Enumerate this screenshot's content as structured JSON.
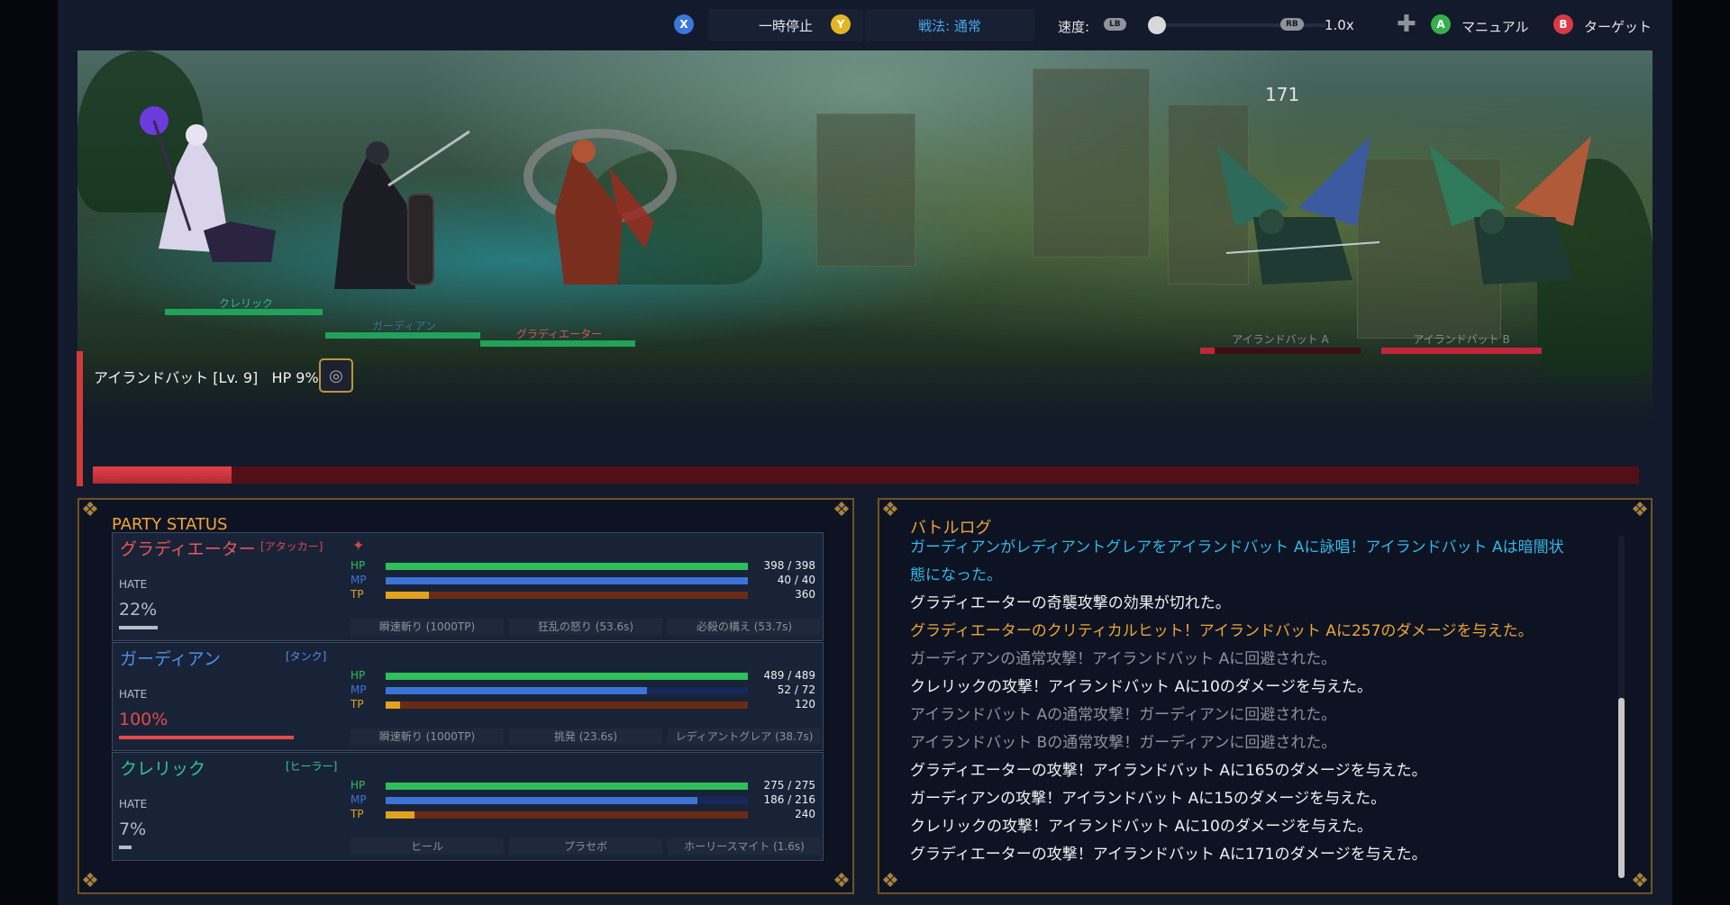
{
  "controls": {
    "pause": {
      "key": "X",
      "label": "一時停止",
      "key_color": "#3a78d8"
    },
    "tactics": {
      "key": "Y",
      "label": "戦法: 通常",
      "key_color": "#e2b623"
    },
    "speed": {
      "label": "速度:",
      "lb": "LB",
      "rb": "RB",
      "value": "1.0x"
    },
    "manual": {
      "key": "A",
      "label": "マニュアル",
      "key_color": "#35b04b"
    },
    "target": {
      "key": "B",
      "label": "ターゲット",
      "key_color": "#d83a45"
    }
  },
  "scene": {
    "damage_popup": "171",
    "party": [
      {
        "name": "クレリック",
        "hp_fraction": 1.0,
        "color": "#21a25a"
      },
      {
        "name": "ガーディアン",
        "hp_fraction": 1.0,
        "color": "#21a25a"
      },
      {
        "name": "グラディエーター",
        "hp_fraction": 1.0,
        "color": "#21a25a"
      }
    ],
    "enemies": [
      {
        "name": "アイランドバット A",
        "hp_fraction": 0.09,
        "color": "#c0263a"
      },
      {
        "name": "アイランドバット B",
        "hp_fraction": 1.0,
        "color": "#c0263a"
      }
    ]
  },
  "target": {
    "label": "アイランドバット [Lv. 9]",
    "hp_text": "HP 9%",
    "hp_fraction": 0.09
  },
  "party_status": {
    "title": "PARTY STATUS",
    "members": [
      {
        "name": "グラディエーター",
        "role": "[アタッカー]",
        "name_color": "#e8575a",
        "role_color": "#d84a4a",
        "hate_label": "HATE",
        "hate_value": "22%",
        "hate_fraction": 0.22,
        "hate_color": "#b8bcc6",
        "hp": {
          "label": "HP",
          "text": "398 / 398",
          "fraction": 1.0
        },
        "mp": {
          "label": "MP",
          "text": "40 / 40",
          "fraction": 1.0
        },
        "tp": {
          "label": "TP",
          "text": "360",
          "fraction": 0.12
        },
        "skills": [
          "瞬速斬り (1000TP)",
          "狂乱の怒り (53.6s)",
          "必殺の構え (53.7s)"
        ]
      },
      {
        "name": "ガーディアン",
        "role": "[タンク]",
        "name_color": "#4f8fe6",
        "role_color": "#4f8fe6",
        "hate_label": "HATE",
        "hate_value": "100%",
        "hate_fraction": 1.0,
        "hate_color": "#e24a4a",
        "hp": {
          "label": "HP",
          "text": "489 / 489",
          "fraction": 1.0
        },
        "mp": {
          "label": "MP",
          "text": "52 / 72",
          "fraction": 0.722
        },
        "tp": {
          "label": "TP",
          "text": "120",
          "fraction": 0.04
        },
        "skills": [
          "瞬速斬り (1000TP)",
          "挑発 (23.6s)",
          "レディアントグレア (38.7s)"
        ]
      },
      {
        "name": "クレリック",
        "role": "[ヒーラー]",
        "name_color": "#2fc68f",
        "role_color": "#2fc68f",
        "hate_label": "HATE",
        "hate_value": "7%",
        "hate_fraction": 0.07,
        "hate_color": "#b8bcc6",
        "hp": {
          "label": "HP",
          "text": "275 / 275",
          "fraction": 1.0
        },
        "mp": {
          "label": "MP",
          "text": "186 / 216",
          "fraction": 0.861
        },
        "tp": {
          "label": "TP",
          "text": "240",
          "fraction": 0.08
        },
        "skills": [
          "ヒール",
          "プラセボ",
          "ホーリースマイト (1.6s)"
        ]
      }
    ]
  },
  "battle_log": {
    "title": "バトルログ",
    "lines": [
      {
        "text": "ガーディアンがレディアントグレアをアイランドバット Aに詠唱！アイランドバット Aは暗闇状",
        "color": "#35b7e6"
      },
      {
        "text": "態になった。",
        "color": "#35b7e6"
      },
      {
        "text": "グラディエーターの奇襲攻撃の効果が切れた。",
        "color": "#f2f2f2"
      },
      {
        "text": "グラディエーターのクリティカルヒット！アイランドバット Aに257のダメージを与えた。",
        "color": "#f0a637"
      },
      {
        "text": "ガーディアンの通常攻撃！アイランドバット Aに回避された。",
        "color": "#8d929c"
      },
      {
        "text": "クレリックの攻撃！アイランドバット Aに10のダメージを与えた。",
        "color": "#f2f2f2"
      },
      {
        "text": "アイランドバット Aの通常攻撃！ガーディアンに回避された。",
        "color": "#8d929c"
      },
      {
        "text": "アイランドバット Bの通常攻撃！ガーディアンに回避された。",
        "color": "#8d929c"
      },
      {
        "text": "グラディエーターの攻撃！アイランドバット Aに165のダメージを与えた。",
        "color": "#f2f2f2"
      },
      {
        "text": "ガーディアンの攻撃！アイランドバット Aに15のダメージを与えた。",
        "color": "#f2f2f2"
      },
      {
        "text": "クレリックの攻撃！アイランドバット Aに10のダメージを与えた。",
        "color": "#f2f2f2"
      },
      {
        "text": "グラディエーターの攻撃！アイランドバット Aに171のダメージを与えた。",
        "color": "#f2f2f2"
      }
    ]
  }
}
